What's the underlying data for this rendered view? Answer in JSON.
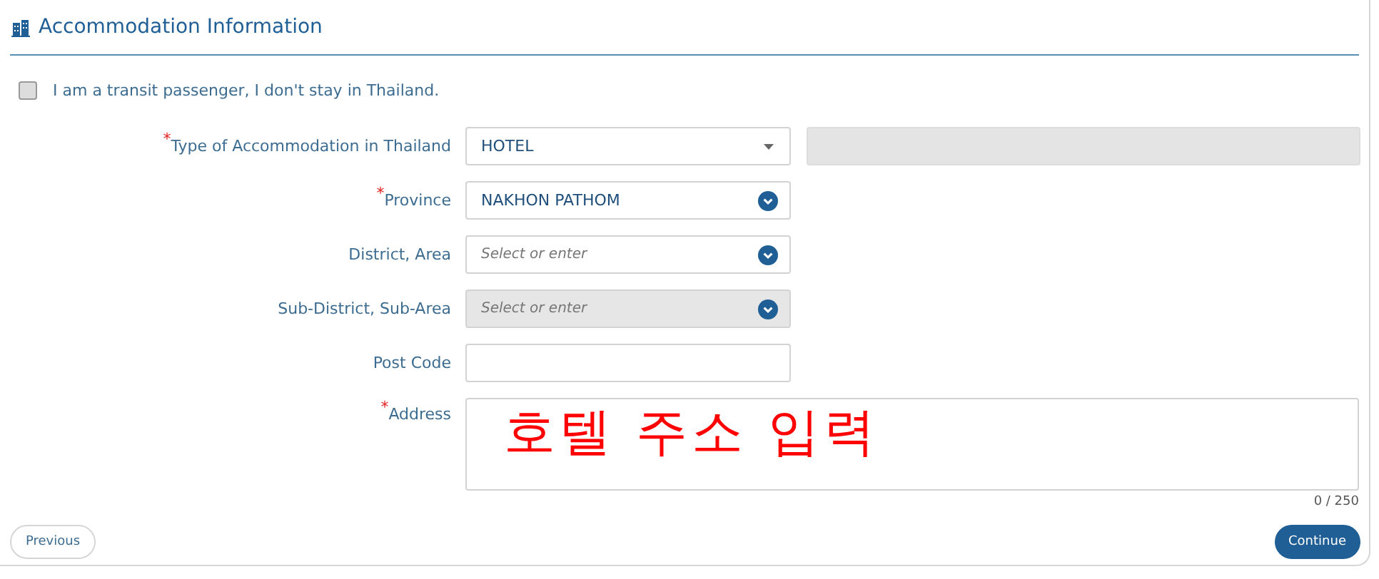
{
  "section": {
    "title": "Accommodation Information"
  },
  "transit": {
    "label": "I am a transit passenger, I don't stay in Thailand.",
    "checked": false
  },
  "fields": [
    {
      "label": "Type of Accommodation in Thailand",
      "required_mark": "*",
      "kind": "select",
      "value": "HOTEL",
      "disabled": false,
      "extra_field": {
        "disabled": true
      }
    },
    {
      "label": "Province",
      "required_mark": "*",
      "kind": "combo",
      "value": "NAKHON PATHOM",
      "disabled": false
    },
    {
      "label": "District, Area",
      "kind": "combo",
      "placeholder": "Select or enter",
      "disabled": false
    },
    {
      "label": "Sub-District, Sub-Area",
      "kind": "combo",
      "placeholder": "Select or enter",
      "disabled": true
    },
    {
      "label": "Post Code",
      "kind": "text",
      "disabled": false
    }
  ],
  "address": {
    "label": "Address",
    "required_mark": "*",
    "counter": "0 / 250",
    "annotation": "호텔 주소 입력"
  },
  "buttons": {
    "previous": "Previous",
    "continue": "Continue"
  }
}
